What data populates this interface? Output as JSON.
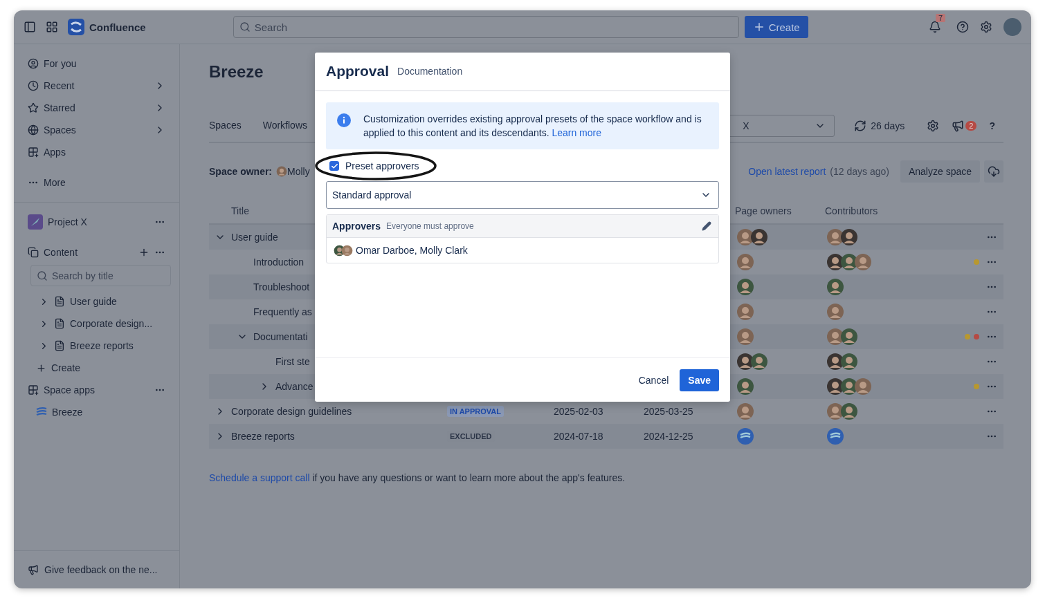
{
  "topbar": {
    "product": "Confluence",
    "search": {
      "placeholder": "Search"
    },
    "create_button": "Create",
    "notifications_badge": "7"
  },
  "sidebar": {
    "nav": [
      {
        "label": "For you",
        "has_submenu": false
      },
      {
        "label": "Recent",
        "has_submenu": true
      },
      {
        "label": "Starred",
        "has_submenu": true
      },
      {
        "label": "Spaces",
        "has_submenu": true
      },
      {
        "label": "Apps",
        "has_submenu": false
      }
    ],
    "more": "More",
    "space_name": "Project X",
    "content_label": "Content",
    "search": {
      "placeholder": "Search by title"
    },
    "tree": [
      {
        "label": "User guide",
        "expanded": false
      },
      {
        "label": "Corporate design...",
        "expanded": false
      },
      {
        "label": "Breeze reports",
        "expanded": false
      }
    ],
    "create": "Create",
    "space_apps_label": "Space apps",
    "apps": [
      {
        "label": "Breeze"
      }
    ],
    "feedback": "Give feedback on the ne..."
  },
  "main": {
    "title": "Breeze",
    "tabs": [
      {
        "label": "Spaces",
        "selected": false
      },
      {
        "label": "Workflows",
        "selected": false
      }
    ],
    "filter_value": "X",
    "refresh": "26 days",
    "announcements_badge": "2",
    "help": "?",
    "owner_label": "Space owner:",
    "owner": "Molly",
    "report_link": "Open latest report",
    "report_age": "(12 days ago)",
    "analyze_button": "Analyze space",
    "table": {
      "columns": {
        "title": "Title",
        "page_owners": "Page owners",
        "contributors": "Contributors"
      },
      "rows": [
        {
          "title": "User guide",
          "expanded": true,
          "owners": [
            {
              "kind": "person",
              "color": "#7d6454"
            },
            {
              "kind": "person",
              "color": "#3a3432"
            }
          ],
          "contributors": [
            {
              "kind": "person",
              "color": "#7d6454"
            },
            {
              "kind": "person",
              "color": "#3a3432"
            }
          ],
          "children": [
            {
              "title": "Introduction",
              "owners": [
                {
                  "kind": "person",
                  "color": "#7d6454"
                }
              ],
              "contributors": [
                {
                  "kind": "person",
                  "color": "#3a3432"
                },
                {
                  "kind": "person",
                  "color": "#3d5640"
                },
                {
                  "kind": "person",
                  "color": "#7d6454"
                }
              ],
              "dots": [
                {
                  "color": "#b8982f"
                }
              ]
            },
            {
              "title": "Troubleshoot",
              "owners": [
                {
                  "kind": "person",
                  "color": "#3d5640"
                }
              ],
              "contributors": [
                {
                  "kind": "person",
                  "color": "#3d5640"
                }
              ]
            },
            {
              "title": "Frequently as",
              "owners": [
                {
                  "kind": "person",
                  "color": "#7d6454"
                }
              ],
              "contributors": [
                {
                  "kind": "person",
                  "color": "#7d6454"
                }
              ]
            },
            {
              "title": "Documentati",
              "expanded": true,
              "owners": [
                {
                  "kind": "person",
                  "color": "#7d6454"
                }
              ],
              "contributors": [
                {
                  "kind": "person",
                  "color": "#7d6454"
                },
                {
                  "kind": "person",
                  "color": "#3d5640"
                }
              ],
              "dots": [
                {
                  "color": "#b8982f"
                },
                {
                  "color": "#b54a44"
                }
              ],
              "children": [
                {
                  "title": "First ste",
                  "owners": [
                    {
                      "kind": "person",
                      "color": "#3a3432"
                    },
                    {
                      "kind": "person",
                      "color": "#3d5640"
                    }
                  ],
                  "contributors": [
                    {
                      "kind": "person",
                      "color": "#3a3432"
                    },
                    {
                      "kind": "person",
                      "color": "#3d5640"
                    }
                  ]
                },
                {
                  "title": "Advance",
                  "expanded": false,
                  "owners": [
                    {
                      "kind": "person",
                      "color": "#3d5640"
                    }
                  ],
                  "contributors": [
                    {
                      "kind": "person",
                      "color": "#3a3432"
                    },
                    {
                      "kind": "person",
                      "color": "#3d5640"
                    },
                    {
                      "kind": "person",
                      "color": "#7d6454"
                    }
                  ],
                  "dots": [
                    {
                      "color": "#b8982f"
                    }
                  ]
                }
              ]
            }
          ]
        },
        {
          "title": "Corporate design guidelines",
          "expanded": false,
          "status": {
            "label": "IN APPROVAL",
            "kind": "approval"
          },
          "created": "2025-02-03",
          "updated": "2025-03-25",
          "owners": [
            {
              "kind": "person",
              "color": "#7d6454"
            }
          ],
          "contributors": [
            {
              "kind": "person",
              "color": "#7d6454"
            },
            {
              "kind": "person",
              "color": "#3d5640"
            }
          ]
        },
        {
          "title": "Breeze reports",
          "expanded": false,
          "status": {
            "label": "EXCLUDED",
            "kind": "excluded"
          },
          "created": "2024-07-18",
          "updated": "2024-12-25",
          "owners": [
            {
              "kind": "app",
              "color": "#2f5fb0"
            }
          ],
          "contributors": [
            {
              "kind": "app",
              "color": "#2f5fb0"
            }
          ]
        }
      ]
    },
    "note_link": "Schedule a support call",
    "note_text": " if you have any questions or want to learn more about the app's features."
  },
  "modal": {
    "title": "Approval",
    "subtitle": "Documentation",
    "info": "Customization overrides existing approval presets of the space workflow and is applied to this content and its descendants.",
    "info_link": "Learn more",
    "preset": {
      "label": "Preset approvers",
      "checked": true,
      "highlighted": true
    },
    "select_value": "Standard approval",
    "approvers": {
      "title": "Approvers",
      "rule": "Everyone must approve",
      "people": "Omar Darboe, Molly Clark",
      "avatars": [
        {
          "kind": "person",
          "color": "#3d5640"
        },
        {
          "kind": "person",
          "color": "#9a7a62"
        }
      ]
    },
    "buttons": {
      "cancel": "Cancel",
      "save": "Save"
    }
  }
}
